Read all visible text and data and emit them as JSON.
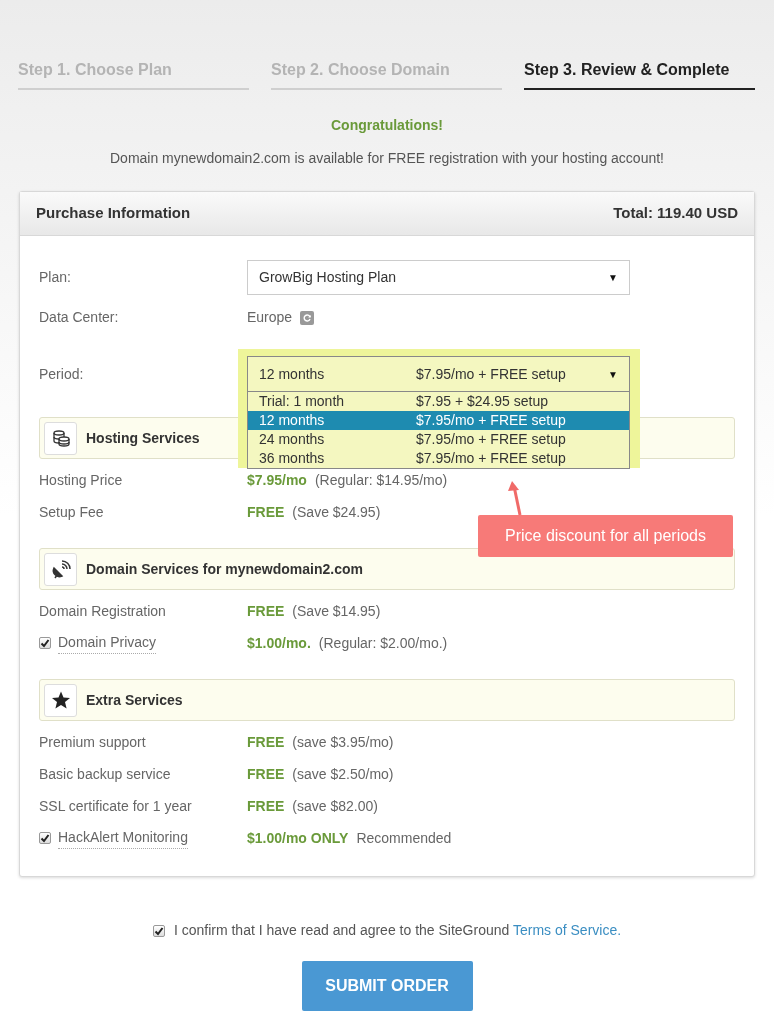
{
  "steps": [
    {
      "label": "Step 1. Choose Plan",
      "selected": false
    },
    {
      "label": "Step 2. Choose Domain",
      "selected": false
    },
    {
      "label": "Step 3. Review & Complete",
      "selected": true
    }
  ],
  "congratulations": "Congratulations!",
  "availability": "Domain mynewdomain2.com is available for FREE registration with your hosting account!",
  "purchase": {
    "title": "Purchase Information",
    "total": "Total: 119.40 USD"
  },
  "plan": {
    "label": "Plan:",
    "value": "GrowBig Hosting Plan",
    "caret": "▼"
  },
  "data_center": {
    "label": "Data Center:",
    "value": "Europe"
  },
  "period": {
    "label": "Period:",
    "term": "12 months",
    "price": "$7.95/mo + FREE setup",
    "caret": "▼",
    "options": [
      {
        "term": "Trial: 1 month",
        "price": "$7.95 + $24.95 setup",
        "selected": false
      },
      {
        "term": "12 months",
        "price": "$7.95/mo + FREE setup",
        "selected": true
      },
      {
        "term": "24 months",
        "price": "$7.95/mo + FREE setup",
        "selected": false
      },
      {
        "term": "36 months",
        "price": "$7.95/mo + FREE setup",
        "selected": false
      }
    ]
  },
  "sections": [
    {
      "title": "Hosting Services",
      "rows": [
        {
          "kind": "plain",
          "label": "Hosting Price",
          "value": "$7.95/mo",
          "note": "(Regular: $14.95/mo)"
        },
        {
          "kind": "plain",
          "label": "Setup Fee",
          "value": "FREE",
          "note": "(Save $24.95)"
        }
      ]
    },
    {
      "title": "Domain Services for mynewdomain2.com",
      "rows": [
        {
          "kind": "plain",
          "label": "Domain Registration",
          "value": "FREE",
          "note": "(Save $14.95)"
        },
        {
          "kind": "checkbox",
          "checked": true,
          "label": "Domain Privacy",
          "value": "$1.00/mo.",
          "note": "(Regular: $2.00/mo.)"
        }
      ]
    },
    {
      "title": "Extra Services",
      "rows": [
        {
          "kind": "plain",
          "label": "Premium support",
          "value": "FREE",
          "note": "(save $3.95/mo)"
        },
        {
          "kind": "plain",
          "label": "Basic backup service",
          "value": "FREE",
          "note": "(save $2.50/mo)"
        },
        {
          "kind": "plain",
          "label": "SSL certificate for 1 year",
          "value": "FREE",
          "note": "(save $82.00)"
        },
        {
          "kind": "checkbox",
          "checked": true,
          "label": "HackAlert Monitoring",
          "value": "$1.00/mo ONLY",
          "note": "Recommended"
        }
      ]
    }
  ],
  "annotation": "Price discount for all periods",
  "confirm": {
    "checked": true,
    "text": "I confirm that I have read and agree to the SiteGround",
    "link": "Terms of Service."
  },
  "submit": "SUBMIT ORDER"
}
